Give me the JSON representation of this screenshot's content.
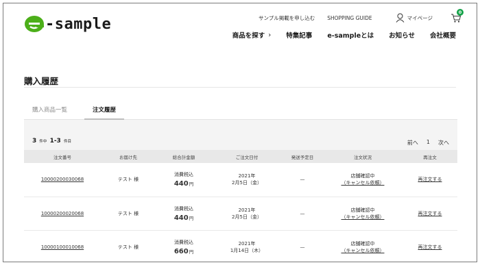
{
  "brand": {
    "logo_text": "-sample",
    "logo_color": "#4caf1a"
  },
  "util_nav": {
    "apply_sample": "サンプル掲載を申し込む",
    "shopping_guide": "SHOPPING GUIDE",
    "mypage": "マイページ",
    "cart_count": "0"
  },
  "main_nav": {
    "items": [
      {
        "label": "商品を探す",
        "chevron": "›"
      },
      {
        "label": "特集記事"
      },
      {
        "label": "e-sampleとは"
      },
      {
        "label": "お知らせ"
      },
      {
        "label": "会社概要"
      }
    ]
  },
  "page": {
    "title": "購入履歴"
  },
  "tabs": [
    {
      "label": "購入商品一覧",
      "active": false
    },
    {
      "label": "注文履歴",
      "active": true
    }
  ],
  "summary": {
    "total": "3",
    "total_suffix": "件中",
    "range": "1-3",
    "range_suffix": "件目"
  },
  "pager": {
    "prev": "前へ",
    "page": "1",
    "next": "次へ"
  },
  "table": {
    "headers": [
      "注文番号",
      "お届け先",
      "総合計金額",
      "ご注文日付",
      "発送予定日",
      "注文状況",
      "再注文"
    ],
    "rows": [
      {
        "order_no": "10000200030068",
        "recipient": "テスト 様",
        "price_label": "消費税込",
        "price": "440",
        "yen": "円",
        "date_year": "2021年",
        "date_day": "2月5日（金）",
        "ship_date": "—",
        "status": "店舗確認中",
        "cancel": "（キャンセル依頼）",
        "reorder": "再注文する"
      },
      {
        "order_no": "10000200020068",
        "recipient": "テスト 様",
        "price_label": "消費税込",
        "price": "440",
        "yen": "円",
        "date_year": "2021年",
        "date_day": "2月5日（金）",
        "ship_date": "—",
        "status": "店舗確認中",
        "cancel": "（キャンセル依頼）",
        "reorder": "再注文する"
      },
      {
        "order_no": "10000100010068",
        "recipient": "テスト 様",
        "price_label": "消費税込",
        "price": "660",
        "yen": "円",
        "date_year": "2021年",
        "date_day": "1月14日（木）",
        "ship_date": "—",
        "status": "店舗確認中",
        "cancel": "（キャンセル依頼）",
        "reorder": "再注文する"
      }
    ]
  }
}
